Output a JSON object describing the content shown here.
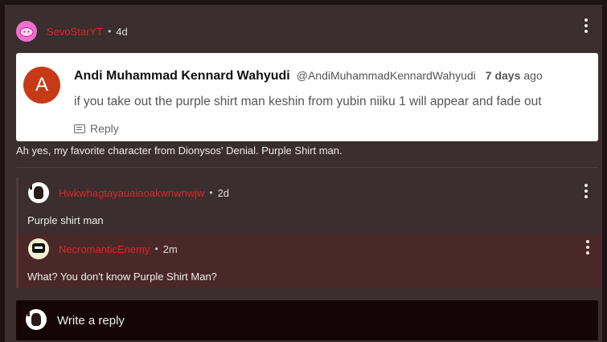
{
  "post": {
    "username": "SevoStarYT",
    "age": "4d",
    "caption": "Ah yes, my favorite character from Dionysos' Denial. Purple Shirt man."
  },
  "quoted_comment": {
    "avatar_letter": "A",
    "author": "Andi Muhammad Kennard Wahyudi",
    "handle": "@AndiMuhammadKennardWahyudi",
    "when_bold": "7 days",
    "when_suffix": "ago",
    "text": "if you take out the purple shirt man keshin from yubin niiku 1 will appear and fade out",
    "reply_label": "Reply"
  },
  "replies": [
    {
      "username": "Hwkwhagtayauaiaoakwnwnwjw",
      "age": "2d",
      "text": "Purple shirt man"
    },
    {
      "username": "NecromanticEnemy",
      "age": "2m",
      "text": "What? You don't know Purple Shirt Man?"
    }
  ],
  "compose": {
    "placeholder": "Write a reply"
  },
  "separator": "•",
  "colors": {
    "username": "#d92626",
    "background": "#3b2e2e",
    "highlight": "#4a2828"
  }
}
